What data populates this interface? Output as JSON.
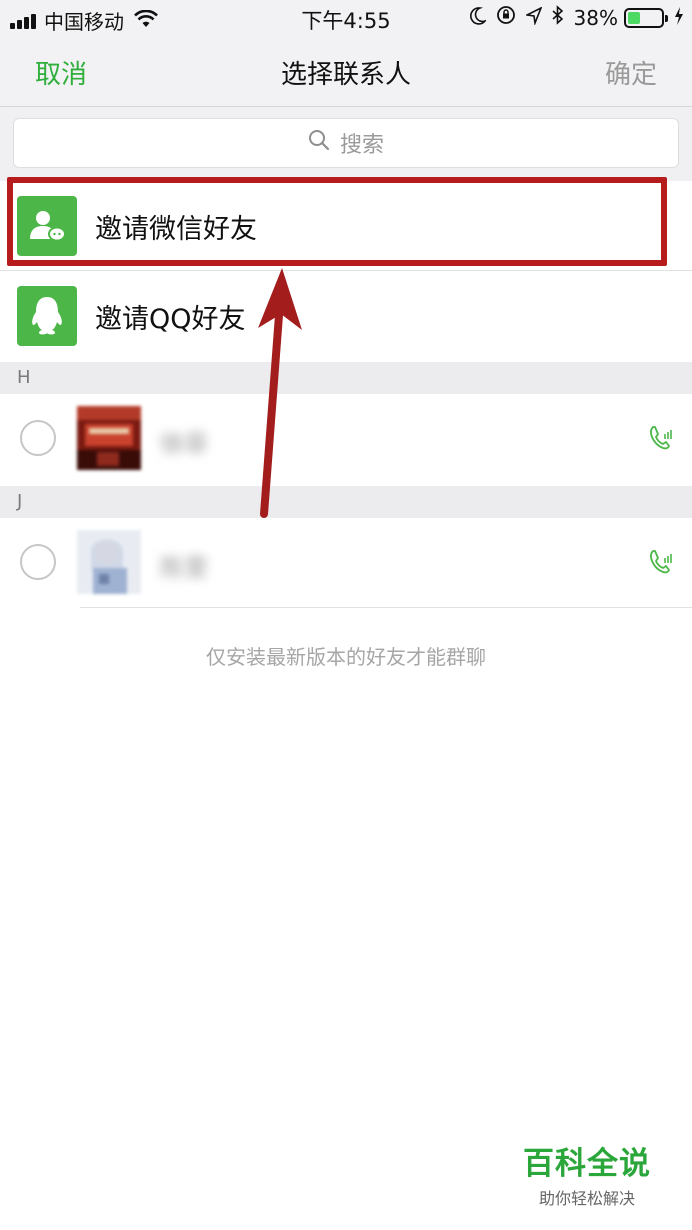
{
  "status_bar": {
    "carrier": "中国移动",
    "time": "下午4:55",
    "battery_text": "38%",
    "battery_level": 0.38,
    "icons": [
      "signal-icon",
      "wifi-icon",
      "moon-icon",
      "rotation-lock-icon",
      "location-icon",
      "bluetooth-icon",
      "battery-icon",
      "charging-icon"
    ]
  },
  "nav": {
    "cancel_label": "取消",
    "title": "选择联系人",
    "confirm_label": "确定"
  },
  "search": {
    "placeholder": "搜索"
  },
  "invite": {
    "wechat_label": "邀请微信好友",
    "qq_label": "邀请QQ好友"
  },
  "sections": [
    {
      "letter": "H",
      "contacts": [
        {
          "name": "徐菲"
        }
      ]
    },
    {
      "letter": "J",
      "contacts": [
        {
          "name": "陈雯"
        }
      ]
    }
  ],
  "footer_note": "仅安装最新版本的好友才能群聊",
  "watermark": {
    "main": "百科全说",
    "sub": "助你轻松解决"
  },
  "colors": {
    "accent": "#2fae3c",
    "icon_bg": "#4cb748",
    "highlight": "#b71c1c",
    "arrow": "#a31d1d"
  }
}
